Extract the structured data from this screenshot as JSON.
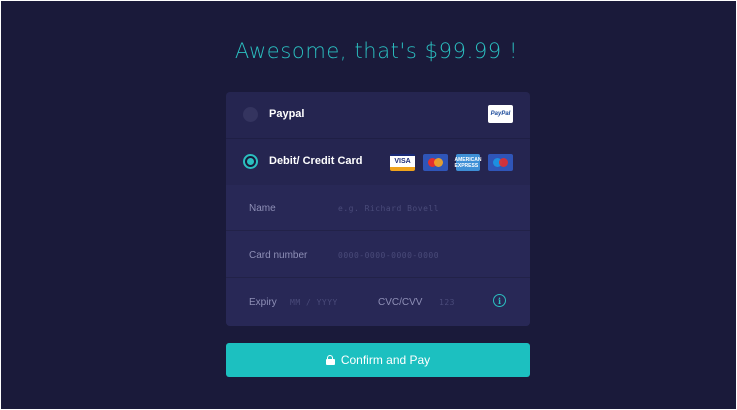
{
  "headline": "Awesome, that's $99.99 !",
  "payment_options": {
    "paypal": {
      "label": "Paypal",
      "logo_text": "PayPal",
      "selected": false
    },
    "card": {
      "label": "Debit/ Credit Card",
      "selected": true,
      "logos": {
        "visa": "VISA",
        "amex": "AMERICAN EXPRESS"
      }
    }
  },
  "fields": {
    "name": {
      "label": "Name",
      "placeholder": "e.g. Richard Bovell"
    },
    "card_number": {
      "label": "Card number",
      "placeholder": "0000-0000-0000-0000"
    },
    "expiry": {
      "label": "Expiry",
      "placeholder": "MM / YYYY"
    },
    "cvc": {
      "label": "CVC/CVV",
      "placeholder": "123"
    },
    "info_icon_glyph": "i"
  },
  "confirm_button": {
    "label": "Confirm and Pay"
  },
  "colors": {
    "background": "#1a1a3a",
    "panel": "#252550",
    "accent": "#2bbfc0",
    "button": "#1cc0c0"
  }
}
